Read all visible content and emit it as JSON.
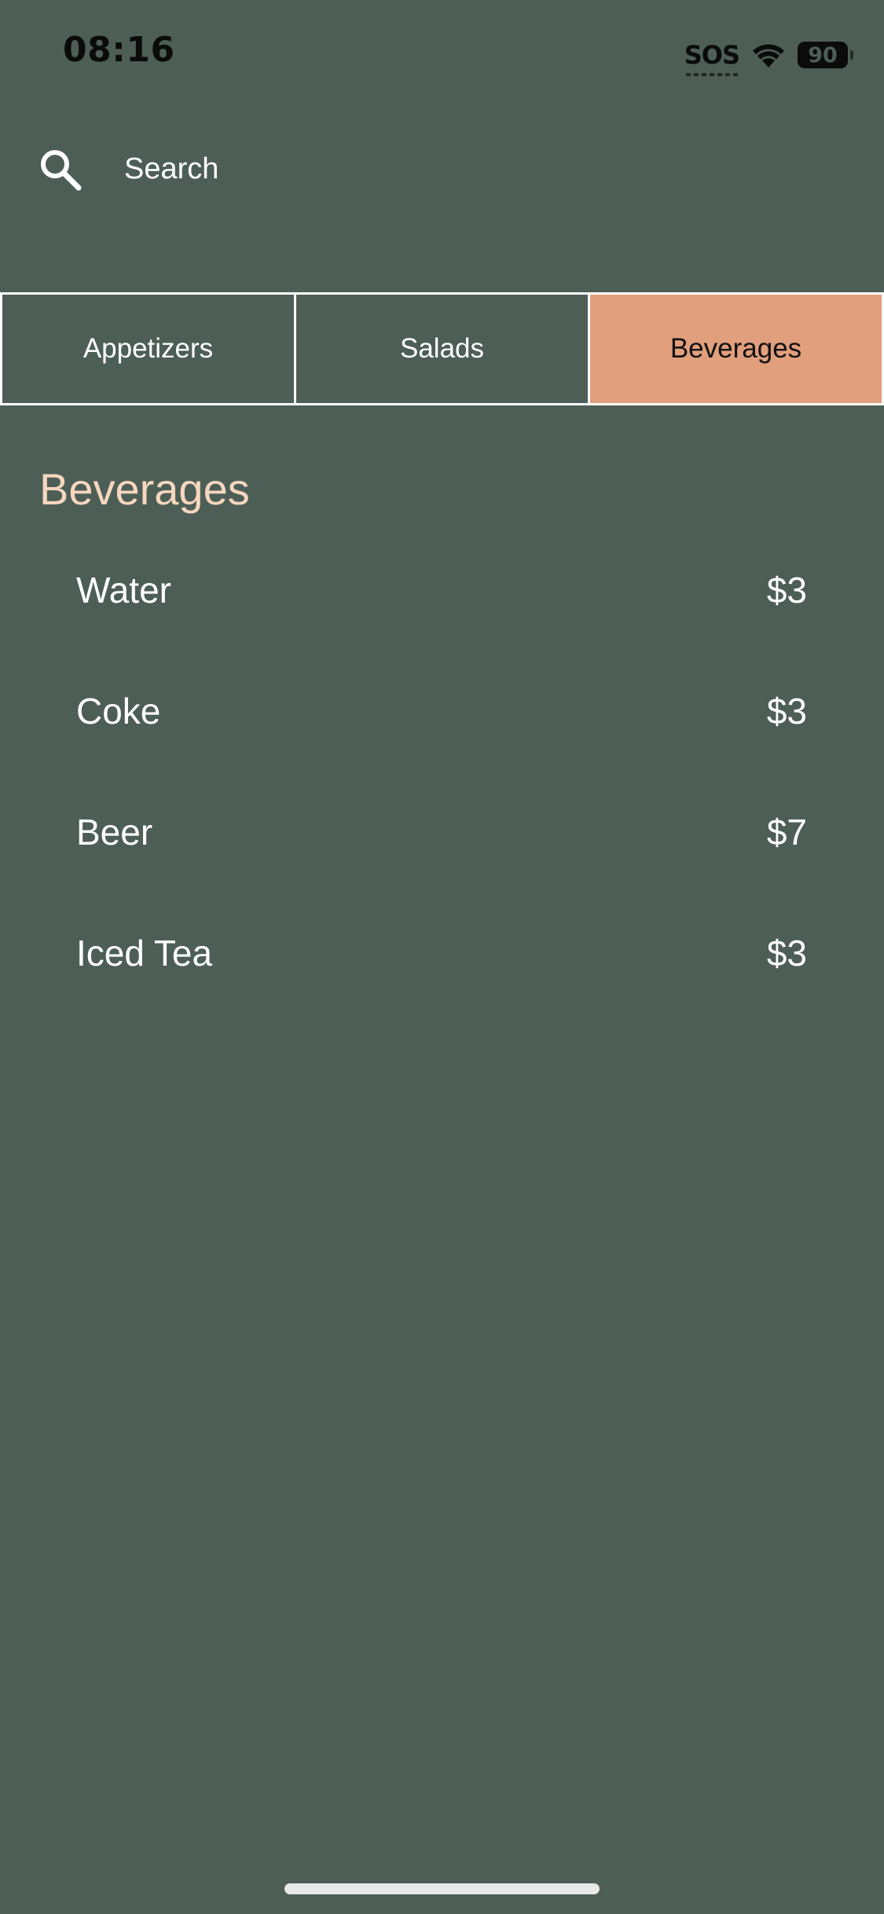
{
  "status_bar": {
    "time": "08:16",
    "sos": "SOS",
    "battery": "90",
    "icons": [
      "wifi-icon",
      "battery-icon"
    ]
  },
  "search": {
    "placeholder": "Search",
    "icon": "search-icon"
  },
  "tabs": [
    {
      "label": "Appetizers",
      "active": false
    },
    {
      "label": "Salads",
      "active": false
    },
    {
      "label": "Beverages",
      "active": true
    }
  ],
  "section": {
    "title": "Beverages",
    "items": [
      {
        "name": "Water",
        "price": "$3"
      },
      {
        "name": "Coke",
        "price": "$3"
      },
      {
        "name": "Beer",
        "price": "$7"
      },
      {
        "name": "Iced Tea",
        "price": "$3"
      }
    ]
  },
  "colors": {
    "background": "#4d5e57",
    "active_tab": "#e19f7d",
    "section_title": "#f6d7bd",
    "text": "#ffffff"
  }
}
